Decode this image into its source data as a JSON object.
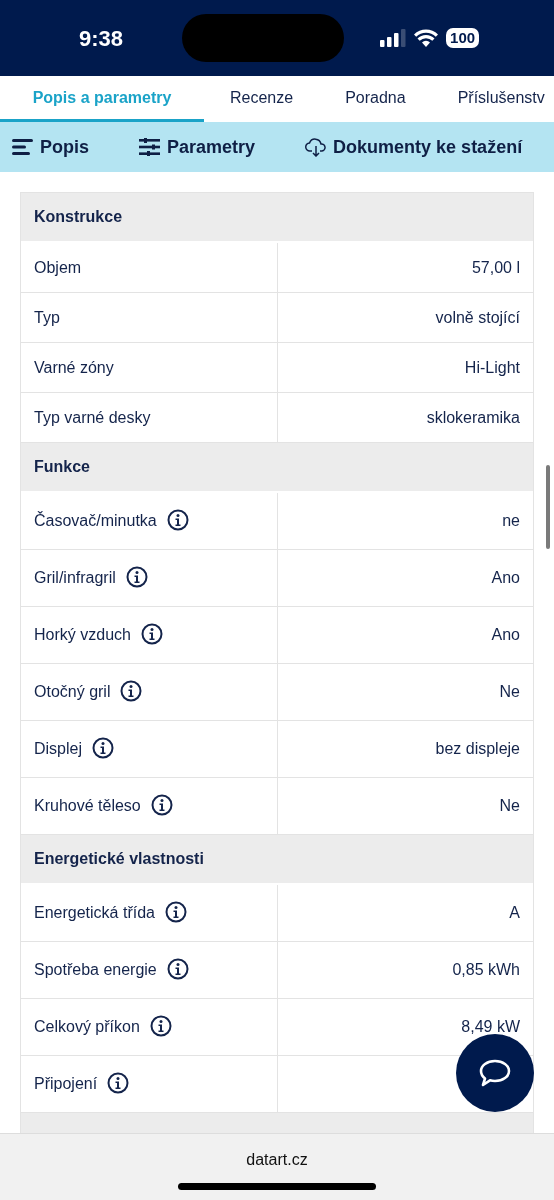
{
  "status_bar": {
    "time": "9:38",
    "battery": "100"
  },
  "tabs": [
    {
      "label": "Popis a parametry",
      "selected": true
    },
    {
      "label": "Recenze",
      "selected": false
    },
    {
      "label": "Poradna",
      "selected": false
    },
    {
      "label": "Příslušenstv",
      "selected": false
    }
  ],
  "subnav": [
    {
      "kind": "lines",
      "label": "Popis"
    },
    {
      "kind": "sliders",
      "label": "Parametry"
    },
    {
      "kind": "download",
      "label": "Dokumenty ke stažení"
    }
  ],
  "sections": [
    {
      "title": "Konstrukce",
      "rows": [
        {
          "label": "Objem",
          "value": "57,00 l",
          "info": false
        },
        {
          "label": "Typ",
          "value": "volně stojící",
          "info": false
        },
        {
          "label": "Varné zóny",
          "value": "Hi-Light",
          "info": false
        },
        {
          "label": "Typ varné desky",
          "value": "sklokeramika",
          "info": false
        }
      ]
    },
    {
      "title": "Funkce",
      "rows": [
        {
          "label": "Časovač/minutka",
          "value": "ne",
          "info": true
        },
        {
          "label": "Gril/infragril",
          "value": "Ano",
          "info": true
        },
        {
          "label": "Horký vzduch",
          "value": "Ano",
          "info": true
        },
        {
          "label": "Otočný gril",
          "value": "Ne",
          "info": true
        },
        {
          "label": "Displej",
          "value": "bez displeje",
          "info": true
        },
        {
          "label": "Kruhové těleso",
          "value": "Ne",
          "info": true
        }
      ]
    },
    {
      "title": "Energetické vlastnosti",
      "rows": [
        {
          "label": "Energetická třída",
          "value": "A",
          "info": true
        },
        {
          "label": "Spotřeba energie",
          "value": "0,85 kWh",
          "info": true
        },
        {
          "label": "Celkový příkon",
          "value": "8,49 kW",
          "info": true
        },
        {
          "label": "Připojení",
          "info": true
        }
      ]
    }
  ],
  "address_bar": {
    "url": "datart.cz"
  }
}
